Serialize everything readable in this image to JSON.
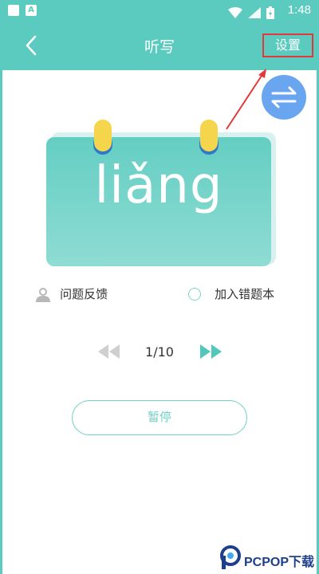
{
  "status_bar": {
    "time": "1:48",
    "app_icon_letter": "A"
  },
  "nav": {
    "back_icon": "chevron-left-icon",
    "title": "听写",
    "settings_label": "设置"
  },
  "swap_button": {
    "icon": "swap-arrows-icon",
    "color": "#6aa6f0"
  },
  "card": {
    "pinyin": "liǎng"
  },
  "actions": {
    "feedback_label": "问题反馈",
    "wrongbook_label": "加入错题本"
  },
  "pager": {
    "progress": "1/10",
    "current": 1,
    "total": 10
  },
  "pause_label": "暂停",
  "watermark": {
    "text": "PCPOP下载"
  },
  "colors": {
    "teal": "#5ccbbf",
    "highlight": "#e23a3a",
    "ring_yellow": "#f5d54c",
    "ring_blue": "#2f79c6"
  }
}
